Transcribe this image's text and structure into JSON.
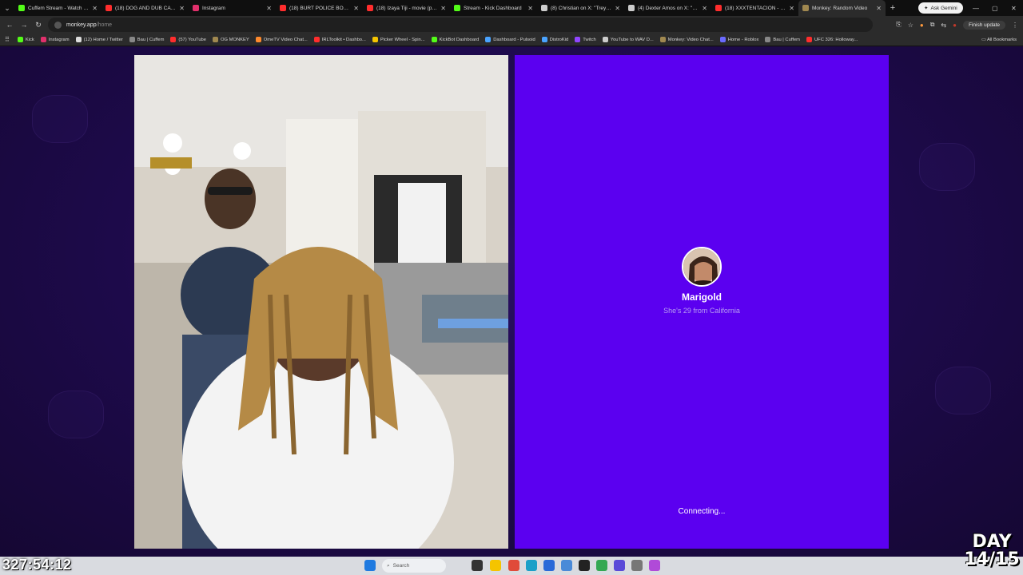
{
  "browser": {
    "tabs": [
      {
        "title": "Cuffem Stream - Watch Liv",
        "color": "#53fc18"
      },
      {
        "title": "(18) DOG AND DUB CATCH",
        "color": "#ff2d2d"
      },
      {
        "title": "Instagram",
        "color": "#e1306c"
      },
      {
        "title": "(18) BURT POLICE BODYCA",
        "color": "#ff2d2d"
      },
      {
        "title": "(18) Izaya Tiji - movie (prod",
        "color": "#ff2d2d"
      },
      {
        "title": "Stream - Kick Dashboard",
        "color": "#53fc18"
      },
      {
        "title": "(8) Christian on X: \"Trey ge",
        "color": "#cccccc"
      },
      {
        "title": "(4) Dexter Amos on X: \"Lea",
        "color": "#cccccc"
      },
      {
        "title": "(18) XXXTENTACION - LOO",
        "color": "#ff2d2d"
      },
      {
        "title": "Monkey: Random Video",
        "color": "#a08850"
      }
    ],
    "ask_gemini": "Ask Gemini",
    "url_host": "monkey.app",
    "url_path": "/home",
    "finish_update": "Finish update",
    "bookmarks": [
      {
        "label": "Kick",
        "color": "#53fc18"
      },
      {
        "label": "Instagram",
        "color": "#e1306c"
      },
      {
        "label": "(12) Home / Twitter",
        "color": "#dddddd"
      },
      {
        "label": "Bau | Cuffem",
        "color": "#888888"
      },
      {
        "label": "(57) YouTube",
        "color": "#ff2d2d"
      },
      {
        "label": "OG MONKEY",
        "color": "#a08850"
      },
      {
        "label": "OmeTV Video Chat...",
        "color": "#ff8a2d"
      },
      {
        "label": "IRLToolkit • Dashbo...",
        "color": "#ff2d2d"
      },
      {
        "label": "Picker Wheel - Spin...",
        "color": "#f5c400"
      },
      {
        "label": "KickBot Dashboard",
        "color": "#53fc18"
      },
      {
        "label": "Dashboard - Pulsoid",
        "color": "#4aa3ff"
      },
      {
        "label": "DistroKid",
        "color": "#4aa3ff"
      },
      {
        "label": "Twitch",
        "color": "#9146ff"
      },
      {
        "label": "YouTube to WAV D...",
        "color": "#cccccc"
      },
      {
        "label": "Monkey: Video Chat...",
        "color": "#a08850"
      },
      {
        "label": "Home - Roblox",
        "color": "#6a6aff"
      },
      {
        "label": "Bau | Cuffem",
        "color": "#888888"
      },
      {
        "label": "UFC 326: Holloway...",
        "color": "#ff2d2d"
      }
    ],
    "all_bookmarks": "All Bookmarks"
  },
  "match": {
    "name": "Marigold",
    "info": "She's 29 from California",
    "status": "Connecting..."
  },
  "taskbar": {
    "search_placeholder": "Search"
  },
  "overlay": {
    "timer": "327:54:12",
    "day_label": "DAY",
    "day_count": "14/15"
  },
  "colors": {
    "match_panel": "#5b00f0",
    "page_bg": "#1d0a4a"
  }
}
